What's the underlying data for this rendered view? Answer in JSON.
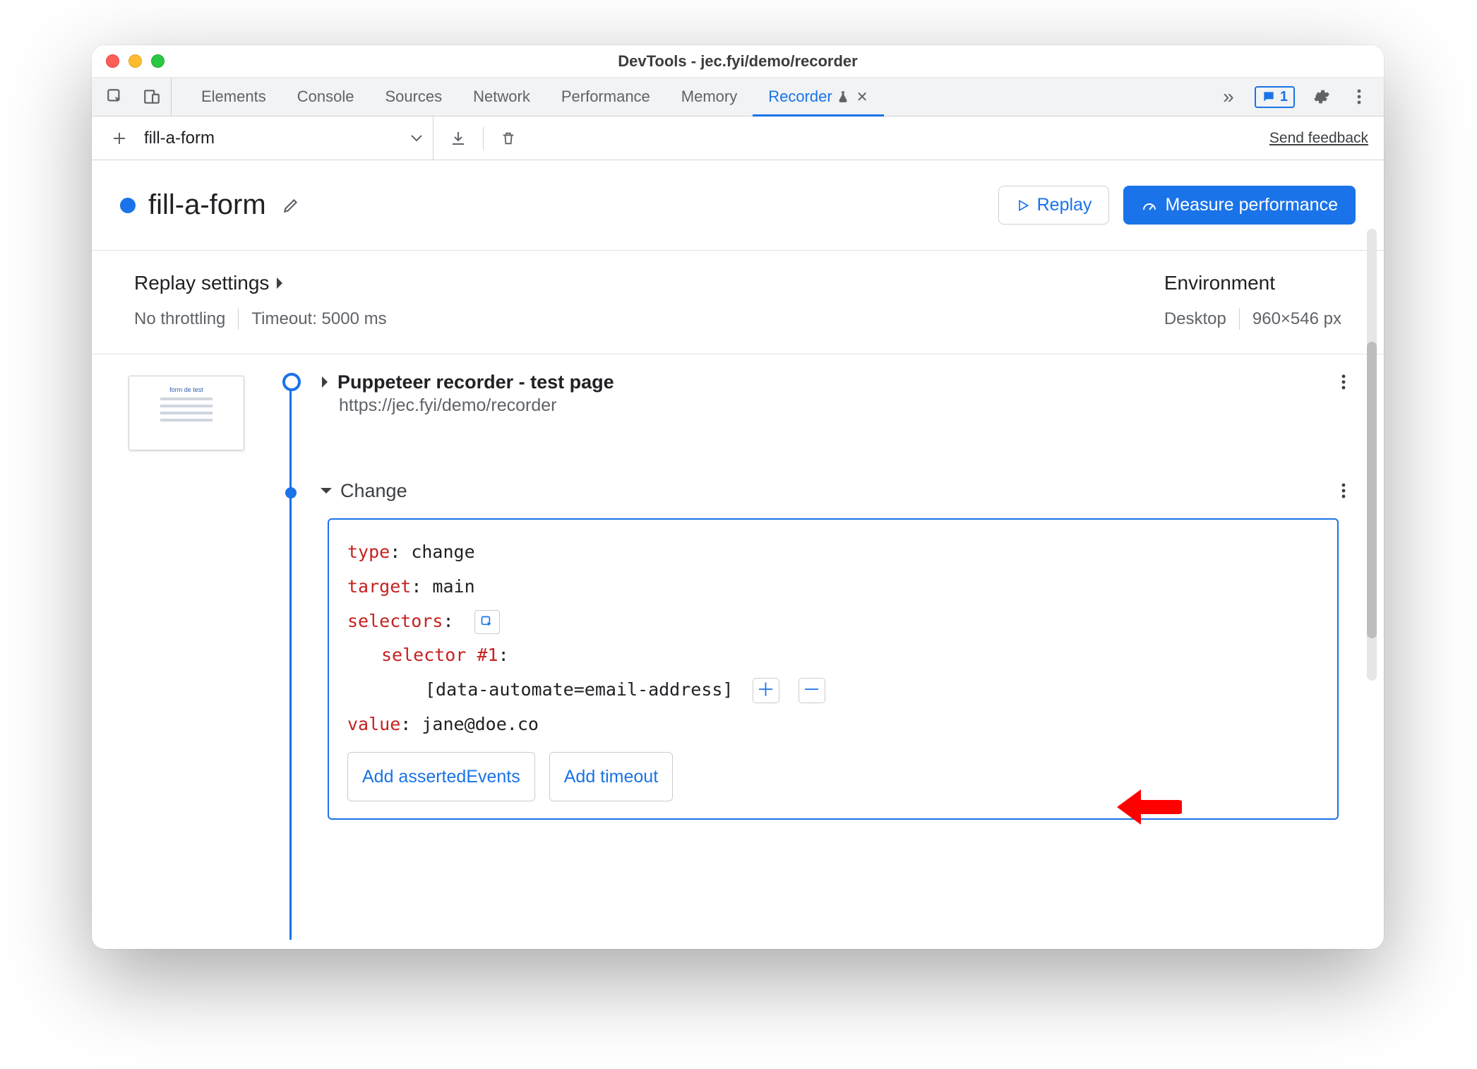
{
  "window": {
    "title": "DevTools - jec.fyi/demo/recorder"
  },
  "devtools_tabs": {
    "items": [
      "Elements",
      "Console",
      "Sources",
      "Network",
      "Performance",
      "Memory",
      "Recorder"
    ],
    "active_index": 6,
    "badge_count": "1"
  },
  "toolbar": {
    "recording_name": "fill-a-form",
    "feedback_label": "Send feedback"
  },
  "header": {
    "title": "fill-a-form",
    "replay_label": "Replay",
    "measure_label": "Measure performance"
  },
  "settings": {
    "left_title": "Replay settings",
    "throttling": "No throttling",
    "timeout": "Timeout: 5000 ms",
    "right_title": "Environment",
    "device": "Desktop",
    "viewport": "960×546 px"
  },
  "steps": {
    "step0": {
      "title": "Puppeteer recorder - test page",
      "url": "https://jec.fyi/demo/recorder"
    },
    "step1": {
      "title": "Change"
    }
  },
  "detail": {
    "keys": {
      "type": "type",
      "target": "target",
      "selectors": "selectors",
      "selectorN": "selector #1",
      "value": "value"
    },
    "values": {
      "type": "change",
      "target": "main",
      "selector1": "[data-automate=email-address]",
      "value": "jane@doe.co"
    },
    "add_asserted": "Add assertedEvents",
    "add_timeout": "Add timeout"
  }
}
